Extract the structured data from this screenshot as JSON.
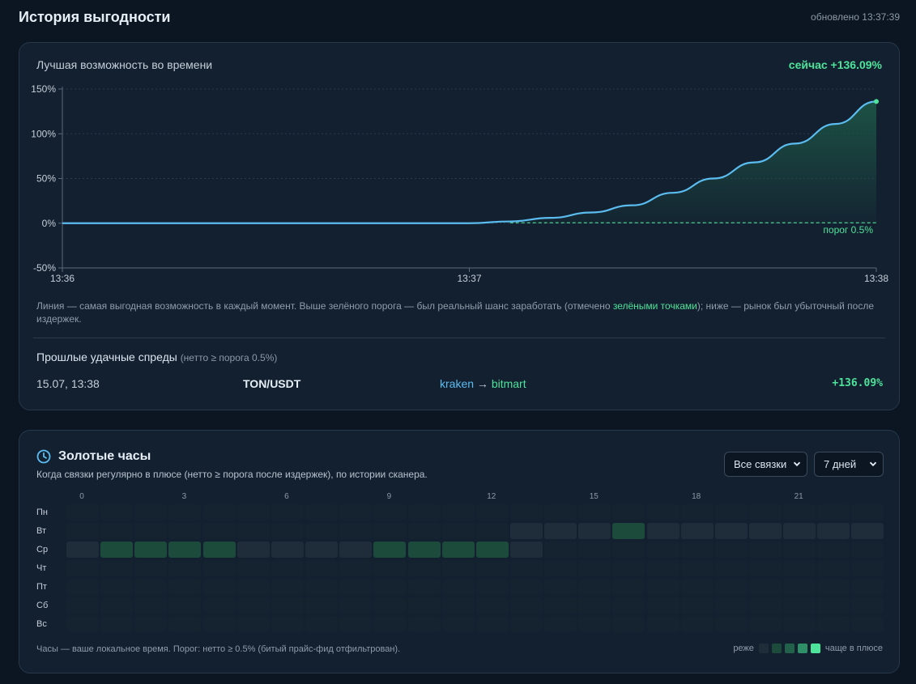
{
  "header": {
    "title": "История выгодности",
    "updated": "обновлено 13:37:39"
  },
  "history": {
    "card_title": "Лучшая возможность во времени",
    "now_label": "сейчас +136.09%",
    "threshold_label": "порог 0.5%",
    "caption_part1": "Линия — самая выгодная возможность в каждый момент. Выше зелёного порога — был реальный шанс заработать (отмечено ",
    "caption_green": "зелёными точками",
    "caption_part2": "); ниже — рынок был убыточный после издержек.",
    "past_title": "Прошлые удачные спреды",
    "past_subtitle": "(нетто ≥ порога 0.5%)",
    "past_spreads": [
      {
        "date": "15.07, 13:38",
        "pair": "TON/USDT",
        "from": "kraken",
        "arrow": " → ",
        "to": "bitmart",
        "pct": "+136.09%"
      }
    ]
  },
  "chart_data": {
    "type": "line",
    "x_ticks": [
      "13:36",
      "13:37",
      "13:38"
    ],
    "y_ticks": [
      "-50%",
      "0%",
      "50%",
      "100%",
      "150%"
    ],
    "ylim": [
      -50,
      150
    ],
    "threshold": 0.5,
    "series": [
      {
        "x": [
          0,
          0.1,
          0.2,
          0.3,
          0.4,
          0.5,
          0.55,
          0.6,
          0.65,
          0.7,
          0.75,
          0.8,
          0.85,
          0.9,
          0.95,
          1.0
        ],
        "values": [
          0,
          0,
          0,
          0,
          0,
          0,
          2,
          6,
          12,
          20,
          34,
          50,
          68,
          89,
          111,
          136.09
        ]
      }
    ],
    "colors": {
      "line": "#5bbcf0",
      "threshold": "#4ee39a",
      "fill": "#1e5a48"
    }
  },
  "golden": {
    "title": "Золотые часы",
    "subtitle": "Когда связки регулярно в плюсе (нетто ≥ порога после издержек), по истории сканера.",
    "select_pairs": "Все связки",
    "select_days": "7 дней",
    "hour_ticks": [
      "0",
      "3",
      "6",
      "9",
      "12",
      "15",
      "18",
      "21"
    ],
    "days": [
      "Пн",
      "Вт",
      "Ср",
      "Чт",
      "Пт",
      "Сб",
      "Вс"
    ],
    "grid": [
      [
        0,
        0,
        0,
        0,
        0,
        0,
        0,
        0,
        0,
        0,
        0,
        0,
        0,
        0,
        0,
        0,
        0,
        0,
        0,
        0,
        0,
        0,
        0,
        0
      ],
      [
        0,
        0,
        0,
        0,
        0,
        0,
        0,
        0,
        0,
        0,
        0,
        0,
        0,
        1,
        1,
        1,
        2,
        1,
        1,
        1,
        1,
        1,
        1,
        1
      ],
      [
        1,
        2,
        2,
        2,
        2,
        1,
        1,
        1,
        1,
        2,
        2,
        2,
        2,
        1,
        0,
        0,
        0,
        0,
        0,
        0,
        0,
        0,
        0,
        0
      ],
      [
        0,
        0,
        0,
        0,
        0,
        0,
        0,
        0,
        0,
        0,
        0,
        0,
        0,
        0,
        0,
        0,
        0,
        0,
        0,
        0,
        0,
        0,
        0,
        0
      ],
      [
        0,
        0,
        0,
        0,
        0,
        0,
        0,
        0,
        0,
        0,
        0,
        0,
        0,
        0,
        0,
        0,
        0,
        0,
        0,
        0,
        0,
        0,
        0,
        0
      ],
      [
        0,
        0,
        0,
        0,
        0,
        0,
        0,
        0,
        0,
        0,
        0,
        0,
        0,
        0,
        0,
        0,
        0,
        0,
        0,
        0,
        0,
        0,
        0,
        0
      ],
      [
        0,
        0,
        0,
        0,
        0,
        0,
        0,
        0,
        0,
        0,
        0,
        0,
        0,
        0,
        0,
        0,
        0,
        0,
        0,
        0,
        0,
        0,
        0,
        0
      ]
    ],
    "footer": "Часы — ваше локальное время. Порог: нетто ≥ 0.5% (битый прайс-фид отфильтрован).",
    "legend_less": "реже",
    "legend_more": "чаще в плюсе",
    "heat_colors": [
      "#15222f",
      "#1f2c3a",
      "#1c4a3b",
      "#22614a",
      "#2f8f66",
      "#4ee39a"
    ]
  }
}
